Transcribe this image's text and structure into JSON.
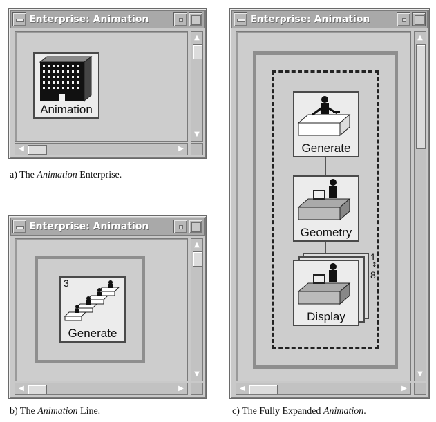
{
  "windows": {
    "a": {
      "title": "Enterprise: Animation",
      "icon_label": "Animation"
    },
    "b": {
      "title": "Enterprise: Animation",
      "icon_label": "Generate",
      "count": "3"
    },
    "c": {
      "title": "Enterprise: Animation",
      "nodes": [
        "Generate",
        "Geometry",
        "Display"
      ],
      "replication": [
        "1",
        "8"
      ]
    }
  },
  "captions": {
    "a": {
      "prefix": "a) The ",
      "emph": "Animation",
      "suffix": " Enterprise."
    },
    "b": {
      "prefix": "b) The ",
      "emph": "Animation",
      "suffix": " Line."
    },
    "c": {
      "prefix": "c) The Fully Expanded ",
      "emph": "Animation",
      "suffix": "."
    }
  },
  "colors": {
    "window_bg": "#c9c9c9",
    "titlebar": "#a9a9a9",
    "frame": "#8e8e8e",
    "icon_bg": "#ececec"
  }
}
